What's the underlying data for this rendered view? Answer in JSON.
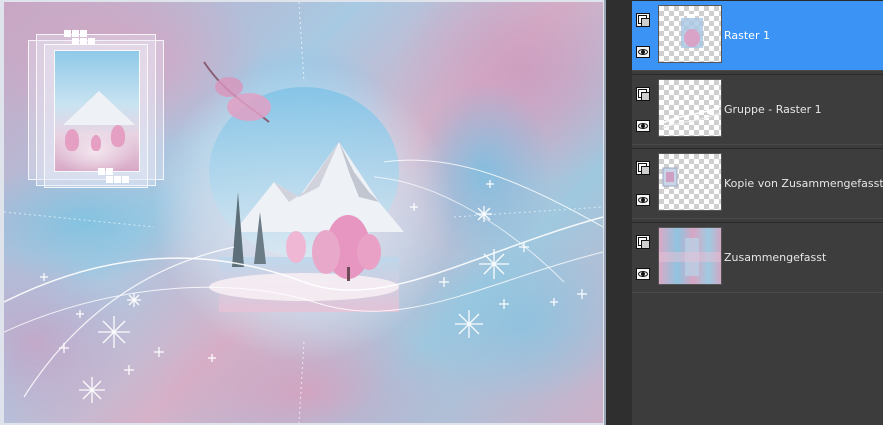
{
  "canvas": {
    "image_description": ""
  },
  "layers_panel": {
    "layers": [
      {
        "name": "Raster 1",
        "selected": true,
        "visible": true,
        "type": "raster"
      },
      {
        "name": "Gruppe - Raster 1",
        "selected": false,
        "visible": true,
        "type": "group"
      },
      {
        "name": "Kopie von Zusammengefasst",
        "selected": false,
        "visible": true,
        "type": "raster"
      },
      {
        "name": "Zusammengefasst",
        "selected": false,
        "visible": true,
        "type": "raster"
      }
    ],
    "icons": {
      "layer_type": "layer-type-icon",
      "visibility": "eye-icon"
    },
    "colors": {
      "selected_row": "#3a93f5",
      "panel_bg": "#3c3c3c"
    }
  }
}
